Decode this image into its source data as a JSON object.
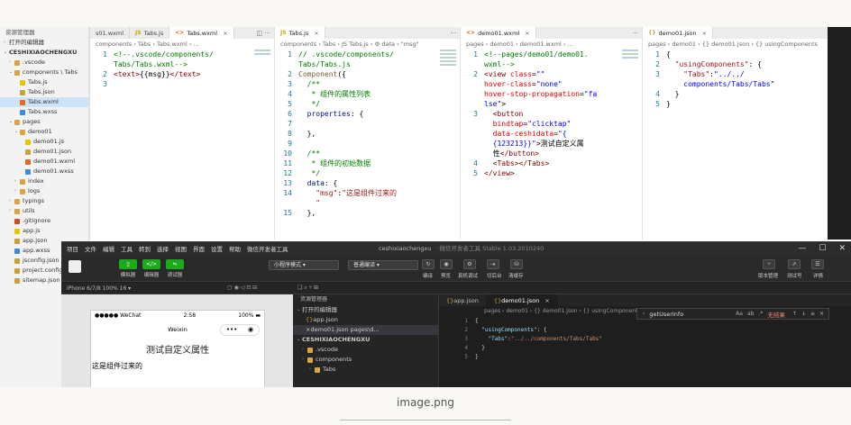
{
  "sidebar": {
    "header": "资源管理器",
    "open_editors": "打开的编辑器",
    "project": "CESHIXIAOCHENGXU",
    "items": [
      {
        "label": ".vscode",
        "icon": "folder",
        "indent": 1,
        "chev": "›"
      },
      {
        "label": "components \\ Tabs",
        "icon": "folder",
        "indent": 1,
        "chev": "⌄"
      },
      {
        "label": "Tabs.js",
        "icon": "js",
        "indent": 2,
        "chev": ""
      },
      {
        "label": "Tabs.json",
        "icon": "json",
        "indent": 2,
        "chev": ""
      },
      {
        "label": "Tabs.wxml",
        "icon": "wxml",
        "indent": 2,
        "chev": "",
        "selected": true
      },
      {
        "label": "Tabs.wxss",
        "icon": "wxss",
        "indent": 2,
        "chev": ""
      },
      {
        "label": "pages",
        "icon": "folder",
        "indent": 1,
        "chev": "⌄"
      },
      {
        "label": "demo01",
        "icon": "folder",
        "indent": 2,
        "chev": "⌄"
      },
      {
        "label": "demo01.js",
        "icon": "js",
        "indent": 3,
        "chev": ""
      },
      {
        "label": "demo01.json",
        "icon": "json",
        "indent": 3,
        "chev": ""
      },
      {
        "label": "demo01.wxml",
        "icon": "wxml",
        "indent": 3,
        "chev": ""
      },
      {
        "label": "demo01.wxss",
        "icon": "wxss",
        "indent": 3,
        "chev": ""
      },
      {
        "label": "index",
        "icon": "folder",
        "indent": 2,
        "chev": "›"
      },
      {
        "label": "logs",
        "icon": "folder",
        "indent": 2,
        "chev": "›"
      },
      {
        "label": "typings",
        "icon": "folder",
        "indent": 1,
        "chev": "›"
      },
      {
        "label": "utils",
        "icon": "folder",
        "indent": 1,
        "chev": "›"
      },
      {
        "label": ".gitignore",
        "icon": "git",
        "indent": 1,
        "chev": ""
      },
      {
        "label": "app.js",
        "icon": "js",
        "indent": 1,
        "chev": ""
      },
      {
        "label": "app.json",
        "icon": "json",
        "indent": 1,
        "chev": ""
      },
      {
        "label": "app.wxss",
        "icon": "wxss",
        "indent": 1,
        "chev": ""
      },
      {
        "label": "jsconfig.json",
        "icon": "json",
        "indent": 1,
        "chev": ""
      },
      {
        "label": "project.config",
        "icon": "json",
        "indent": 1,
        "chev": ""
      },
      {
        "label": "sitemap.json",
        "icon": "json",
        "indent": 1,
        "chev": ""
      }
    ]
  },
  "pane1": {
    "tabs": [
      {
        "label": "s01.wxml",
        "icon": "",
        "active": false
      },
      {
        "label": "Tabs.js",
        "icon": "JS",
        "active": false
      },
      {
        "label": "Tabs.wxml",
        "icon": "<>",
        "active": true
      }
    ],
    "breadcrumb": "components › Tabs › ⁠Tabs.wxml › ...",
    "lines": [
      {
        "n": "1",
        "html": "<span class=\"c-com\">&lt;!--.vscode/components/</span>"
      },
      {
        "n": "",
        "html": "<span class=\"c-com\">Tabs/Tabs.wxml--&gt;</span>"
      },
      {
        "n": "2",
        "html": "<span class=\"c-tag\">&lt;text&gt;</span>{{msg}}<span class=\"c-tag\">&lt;/text&gt;</span>"
      },
      {
        "n": "3",
        "html": ""
      }
    ]
  },
  "pane2": {
    "tabs": [
      {
        "label": "Tabs.js",
        "icon": "JS",
        "active": true
      }
    ],
    "breadcrumb": "components › Tabs › JS Tabs.js › ⚙ data › \"msg\"",
    "lines": [
      {
        "n": "1",
        "html": "<span class=\"c-com\">// .vscode/components/</span>"
      },
      {
        "n": "",
        "html": "<span class=\"c-com\">Tabs/Tabs.js</span>"
      },
      {
        "n": "2",
        "html": "<span class=\"c-fn\">Component</span>({"
      },
      {
        "n": "3",
        "html": "  <span class=\"c-com\">/**</span>"
      },
      {
        "n": "4",
        "html": "  <span class=\"c-com\"> * 组件的属性列表</span>"
      },
      {
        "n": "5",
        "html": "  <span class=\"c-com\"> */</span>"
      },
      {
        "n": "6",
        "html": "  <span class=\"c-key\">properties</span>: {"
      },
      {
        "n": "7",
        "html": ""
      },
      {
        "n": "8",
        "html": "  },"
      },
      {
        "n": "9",
        "html": ""
      },
      {
        "n": "10",
        "html": "  <span class=\"c-com\">/**</span>"
      },
      {
        "n": "11",
        "html": "  <span class=\"c-com\"> * 组件的初始数据</span>"
      },
      {
        "n": "12",
        "html": "  <span class=\"c-com\"> */</span>"
      },
      {
        "n": "13",
        "html": "  <span class=\"c-key\">data</span>: {"
      },
      {
        "n": "14",
        "html": "    <span class=\"c-red\">\"msg\"</span>:<span class=\"c-red\">\"这是组件过来的</span>"
      },
      {
        "n": "",
        "html": "    <span class=\"c-red\">\"</span>"
      },
      {
        "n": "15",
        "html": "  },"
      }
    ]
  },
  "pane3": {
    "tabs": [
      {
        "label": "demo01.wxml",
        "icon": "<>",
        "active": true
      }
    ],
    "breadcrumb": "pages › demo01 › ⁠demo01.wxml › ...",
    "lines": [
      {
        "n": "1",
        "html": "<span class=\"c-com\">&lt;!--pages/demo01/demo01.</span>"
      },
      {
        "n": "",
        "html": "<span class=\"c-com\">wxml--&gt;</span>"
      },
      {
        "n": "2",
        "html": "<span class=\"c-tag\">&lt;view</span> <span class=\"c-attr\">class</span>=<span class=\"c-str\">\"\"</span>"
      },
      {
        "n": "",
        "html": "<span class=\"c-attr\">hover-class</span>=<span class=\"c-str\">\"none\"</span>"
      },
      {
        "n": "",
        "html": "<span class=\"c-attr\">hover-stop-propagation</span>=<span class=\"c-str\">\"fa</span>"
      },
      {
        "n": "",
        "html": "<span class=\"c-str\">lse\"</span>&gt;"
      },
      {
        "n": "3",
        "html": "  <span class=\"c-tag\">&lt;button</span>"
      },
      {
        "n": "",
        "html": "  <span class=\"c-attr\">bindtap</span>=<span class=\"c-str\">\"clicktap\"</span>"
      },
      {
        "n": "",
        "html": "  <span class=\"c-attr\">data-ceshidata</span>=<span class=\"c-str\">\"{</span>"
      },
      {
        "n": "",
        "html": "  <span class=\"c-str\">{123213}}\"</span>&gt;测试自定义属"
      },
      {
        "n": "",
        "html": "  性<span class=\"c-tag\">&lt;/button&gt;</span>"
      },
      {
        "n": "4",
        "html": "  <span class=\"c-tag\">&lt;Tabs&gt;&lt;/Tabs&gt;</span>"
      },
      {
        "n": "5",
        "html": "<span class=\"c-tag\">&lt;/view&gt;</span>"
      }
    ]
  },
  "pane4": {
    "tabs": [
      {
        "label": "demo01.json",
        "icon": "{}",
        "active": true
      }
    ],
    "breadcrumb": "pages › demo01 › {} demo01.json › {} usingComponents",
    "lines": [
      {
        "n": "1",
        "html": "{"
      },
      {
        "n": "2",
        "html": "  <span class=\"c-red\">\"usingComponents\"</span>: {"
      },
      {
        "n": "3",
        "html": "    <span class=\"c-red\">\"Tabs\"</span>:<span class=\"c-str\">\"../../</span>"
      },
      {
        "n": "",
        "html": "    <span class=\"c-str\">components/Tabs/Tabs\"</span>"
      },
      {
        "n": "4",
        "html": "  }"
      },
      {
        "n": "5",
        "html": "}"
      }
    ]
  },
  "devtools": {
    "menu": [
      "项目",
      "文件",
      "编辑",
      "工具",
      "转到",
      "选择",
      "视图",
      "界面",
      "设置",
      "帮助",
      "微信开发者工具"
    ],
    "title": "ceshixiaochengxu",
    "subtitle": "· 微信开发者工具 Stable 1.03.2010240",
    "toolbar": {
      "simulator": "模拟器",
      "editor": "编辑器",
      "debugger": "调试器",
      "mode": "小程序模式",
      "compile_mode": "普通编译",
      "compile": "编译",
      "preview": "预览",
      "real_debug": "真机调试",
      "switch_bg": "切后台",
      "clear_cache": "清缓存",
      "version": "版本管理",
      "test": "测试号",
      "details": "详情"
    },
    "device": "iPhone 6/7/8 100% 16 ▾",
    "phone": {
      "carrier": "●●●●● WeChat",
      "time": "2:58",
      "battery": "100%",
      "nav_title": "Weixin",
      "button_text": "测试自定义属性",
      "component_text": "这是组件过来的"
    },
    "explorer": {
      "header": "资源管理器",
      "open_editors": "打开的编辑器",
      "open_files": [
        {
          "label": "app.json",
          "sel": false
        },
        {
          "label": "demo01.json  pages\\d...",
          "sel": true
        }
      ],
      "project": "CESHIXIAOCHENGXU",
      "rows": [
        ".vscode",
        "components",
        "Tabs"
      ]
    },
    "editor": {
      "tabs": [
        "app.json",
        "demo01.json"
      ],
      "breadcrumb": "pages › demo01 › {} demo01.json › {} usingComponents › ⊟ Tabs",
      "find_term": "getUserInfo",
      "find_result": "无结果",
      "lines": [
        {
          "n": "1",
          "html": "{"
        },
        {
          "n": "2",
          "html": "  <span class=\"d-key\">\"usingComponents\"</span>: {"
        },
        {
          "n": "3",
          "html": "    <span class=\"d-key\">\"Tabs\"</span>:<span class=\"d-str\">\"../../components/Tabs/Tabs\"</span>"
        },
        {
          "n": "4",
          "html": "  }"
        },
        {
          "n": "5",
          "html": "}"
        }
      ]
    }
  },
  "caption": "image.png"
}
